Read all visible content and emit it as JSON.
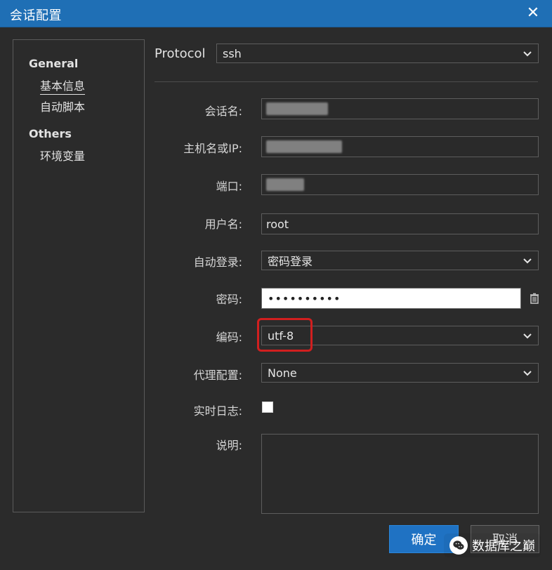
{
  "window": {
    "title": "会话配置",
    "close_icon": "close-icon"
  },
  "sidebar": {
    "groups": [
      {
        "title": "General",
        "items": [
          "基本信息",
          "自动脚本"
        ]
      },
      {
        "title": "Others",
        "items": [
          "环境变量"
        ]
      }
    ],
    "active_item": "基本信息"
  },
  "protocol": {
    "label": "Protocol",
    "value": "ssh"
  },
  "form": {
    "session_name_label": "会话名:",
    "host_label": "主机名或IP:",
    "port_label": "端口:",
    "username_label": "用户名:",
    "username_value": "root",
    "autologin_label": "自动登录:",
    "autologin_value": "密码登录",
    "password_label": "密码:",
    "password_masked": "••••••••••",
    "encoding_label": "编码:",
    "encoding_value": "utf-8",
    "proxy_label": "代理配置:",
    "proxy_value": "None",
    "realtime_log_label": "实时日志:",
    "description_label": "说明:"
  },
  "buttons": {
    "confirm": "确定",
    "cancel": "取消"
  },
  "watermark": {
    "text": "数据库之巅",
    "icon": "wechat-icon"
  },
  "colors": {
    "titlebar": "#1f6fb5",
    "primary_button": "#1f72c3",
    "highlight": "#d11f1f",
    "background": "#2b2b2b"
  }
}
